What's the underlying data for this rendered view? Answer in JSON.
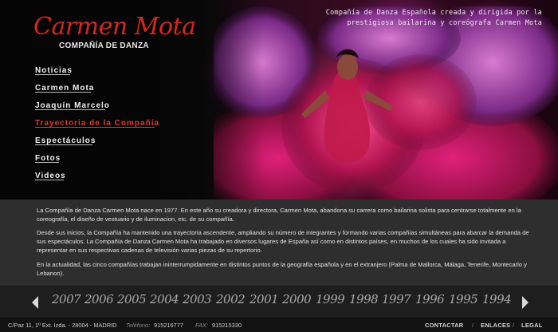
{
  "brand": {
    "logo_script": "Carmen Mota",
    "logo_sub": "COMPAÑÍA DE DANZA",
    "accent": "#d9261c"
  },
  "tagline": "Compañía de Danza Española creada y dirigida por la prestigiosa bailarina y coreógrafa Carmen Mota",
  "nav": {
    "items": [
      {
        "label": "Noticias"
      },
      {
        "label": "Carmen Mota"
      },
      {
        "label": "Joaquín Marcelo"
      },
      {
        "label": "Trayectoria de la Compañía",
        "active": true
      },
      {
        "label": "Espectáculos"
      },
      {
        "label": "Fotos"
      },
      {
        "label": "Videos"
      }
    ]
  },
  "content": {
    "p1": "La Compañía de Danza Carmen Mota nace en 1977. En este año su creadora y directora, Carmen Mota, abandona su carrera como bailarina solista para centrarse totalmente en la coreografía, el diseño de vestuario y de iluminacion, etc. de su compañía.",
    "p2": "Desde sus inicios, la Compañía ha mantenido una trayectoria ascendente, ampliando su número de integrantes y formando varias compañías simultáneas para abarcar la demanda de sus espectáculos. La Compañía de Danza Carmen Mota ha trabajado en diversos lugares de España así como en distintos países, en muchos de los cuales ha sido invitada a representar en sus respectivas cadenas de televisión varias piezas de su repertorio.",
    "p3": "En la actualidad, las cinco compañías trabajan ininterrumpidamente en distintos puntos de la geografía española y en el extranjero (Palma de Mallorca, Málaga, Tenerife, Montecarlo y Lebanon)."
  },
  "timeline": {
    "years": [
      "2007",
      "2006",
      "2005",
      "2004",
      "2003",
      "2002",
      "2001",
      "2000",
      "1999",
      "1998",
      "1997",
      "1996",
      "1995",
      "1994"
    ]
  },
  "footer": {
    "address": "C/Paz 11, 1º Ext. Izda. - 28004 - MADRID",
    "phone_label": "Teléfono:",
    "phone": "915216777",
    "fax_label": "FAX:",
    "fax": "915215330",
    "links": [
      "CONTACTAR",
      "ENLACES",
      "LEGAL"
    ],
    "separator": "/"
  }
}
